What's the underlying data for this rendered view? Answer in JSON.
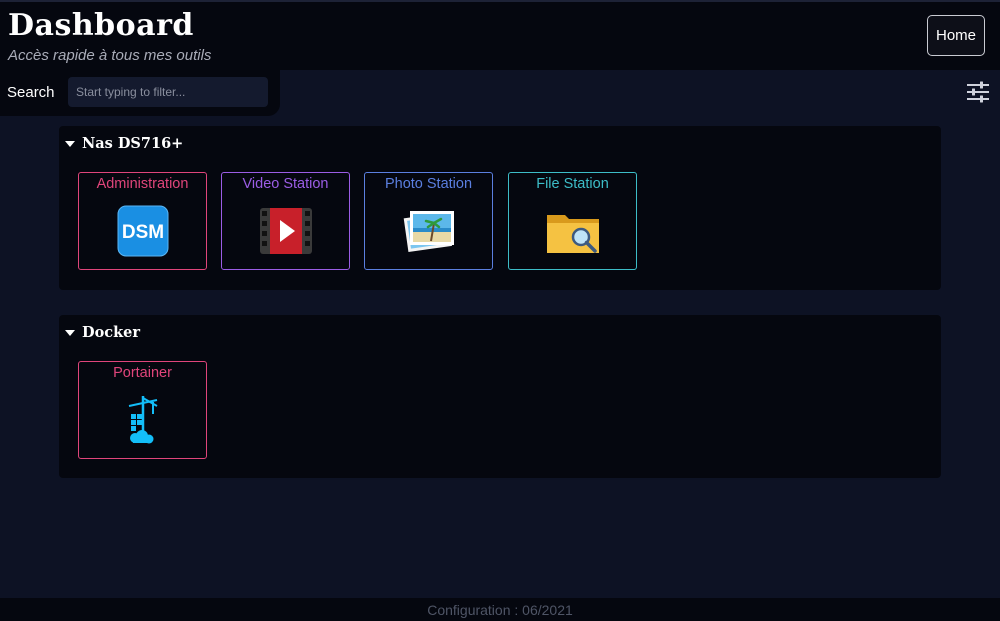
{
  "header": {
    "title": "Dashboard",
    "subtitle": "Accès rapide à tous mes outils",
    "home_label": "Home"
  },
  "search": {
    "label": "Search",
    "placeholder": "Start typing to filter..."
  },
  "settings": {
    "icon": "sliders-icon"
  },
  "sections": [
    {
      "title": "Nas DS716+",
      "items": [
        {
          "label": "Administration",
          "icon": "dsm-icon",
          "color": "#e0457b"
        },
        {
          "label": "Video Station",
          "icon": "video-station-icon",
          "color": "#9b5de5"
        },
        {
          "label": "Photo Station",
          "icon": "photo-station-icon",
          "color": "#5b7fe0"
        },
        {
          "label": "File Station",
          "icon": "file-station-icon",
          "color": "#3dbdc8"
        }
      ]
    },
    {
      "title": "Docker",
      "items": [
        {
          "label": "Portainer",
          "icon": "portainer-icon",
          "color": "#e0457b"
        }
      ]
    }
  ],
  "footer": {
    "text": "Configuration : 06/2021"
  }
}
